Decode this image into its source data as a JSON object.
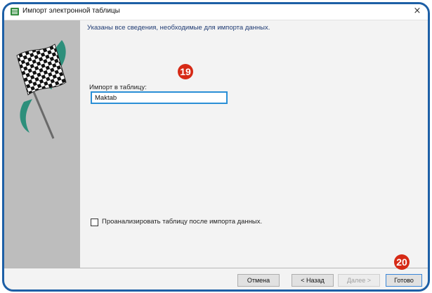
{
  "window": {
    "title": "Импорт электронной таблицы",
    "close_glyph": "×"
  },
  "main": {
    "heading": "Указаны все сведения, необходимые для импорта данных.",
    "import_label": "Импорт в таблицу:",
    "table_name": "Maktab",
    "analyze_checkbox": {
      "label": "Проанализировать таблицу после импорта данных.",
      "checked": false
    }
  },
  "badges": {
    "step_19": "19",
    "step_20": "20"
  },
  "buttons": {
    "cancel": "Отмена",
    "back": "< Назад",
    "next": "Далее >",
    "finish": "Готово"
  },
  "colors": {
    "frame_border": "#1d5fa6",
    "badge": "#d62a16",
    "input_highlight": "#2a8fd6",
    "left_panel": "#bdbdbd"
  },
  "icons": {
    "window": "spreadsheet-icon",
    "wizard_art": "checkered-flag-icon"
  }
}
